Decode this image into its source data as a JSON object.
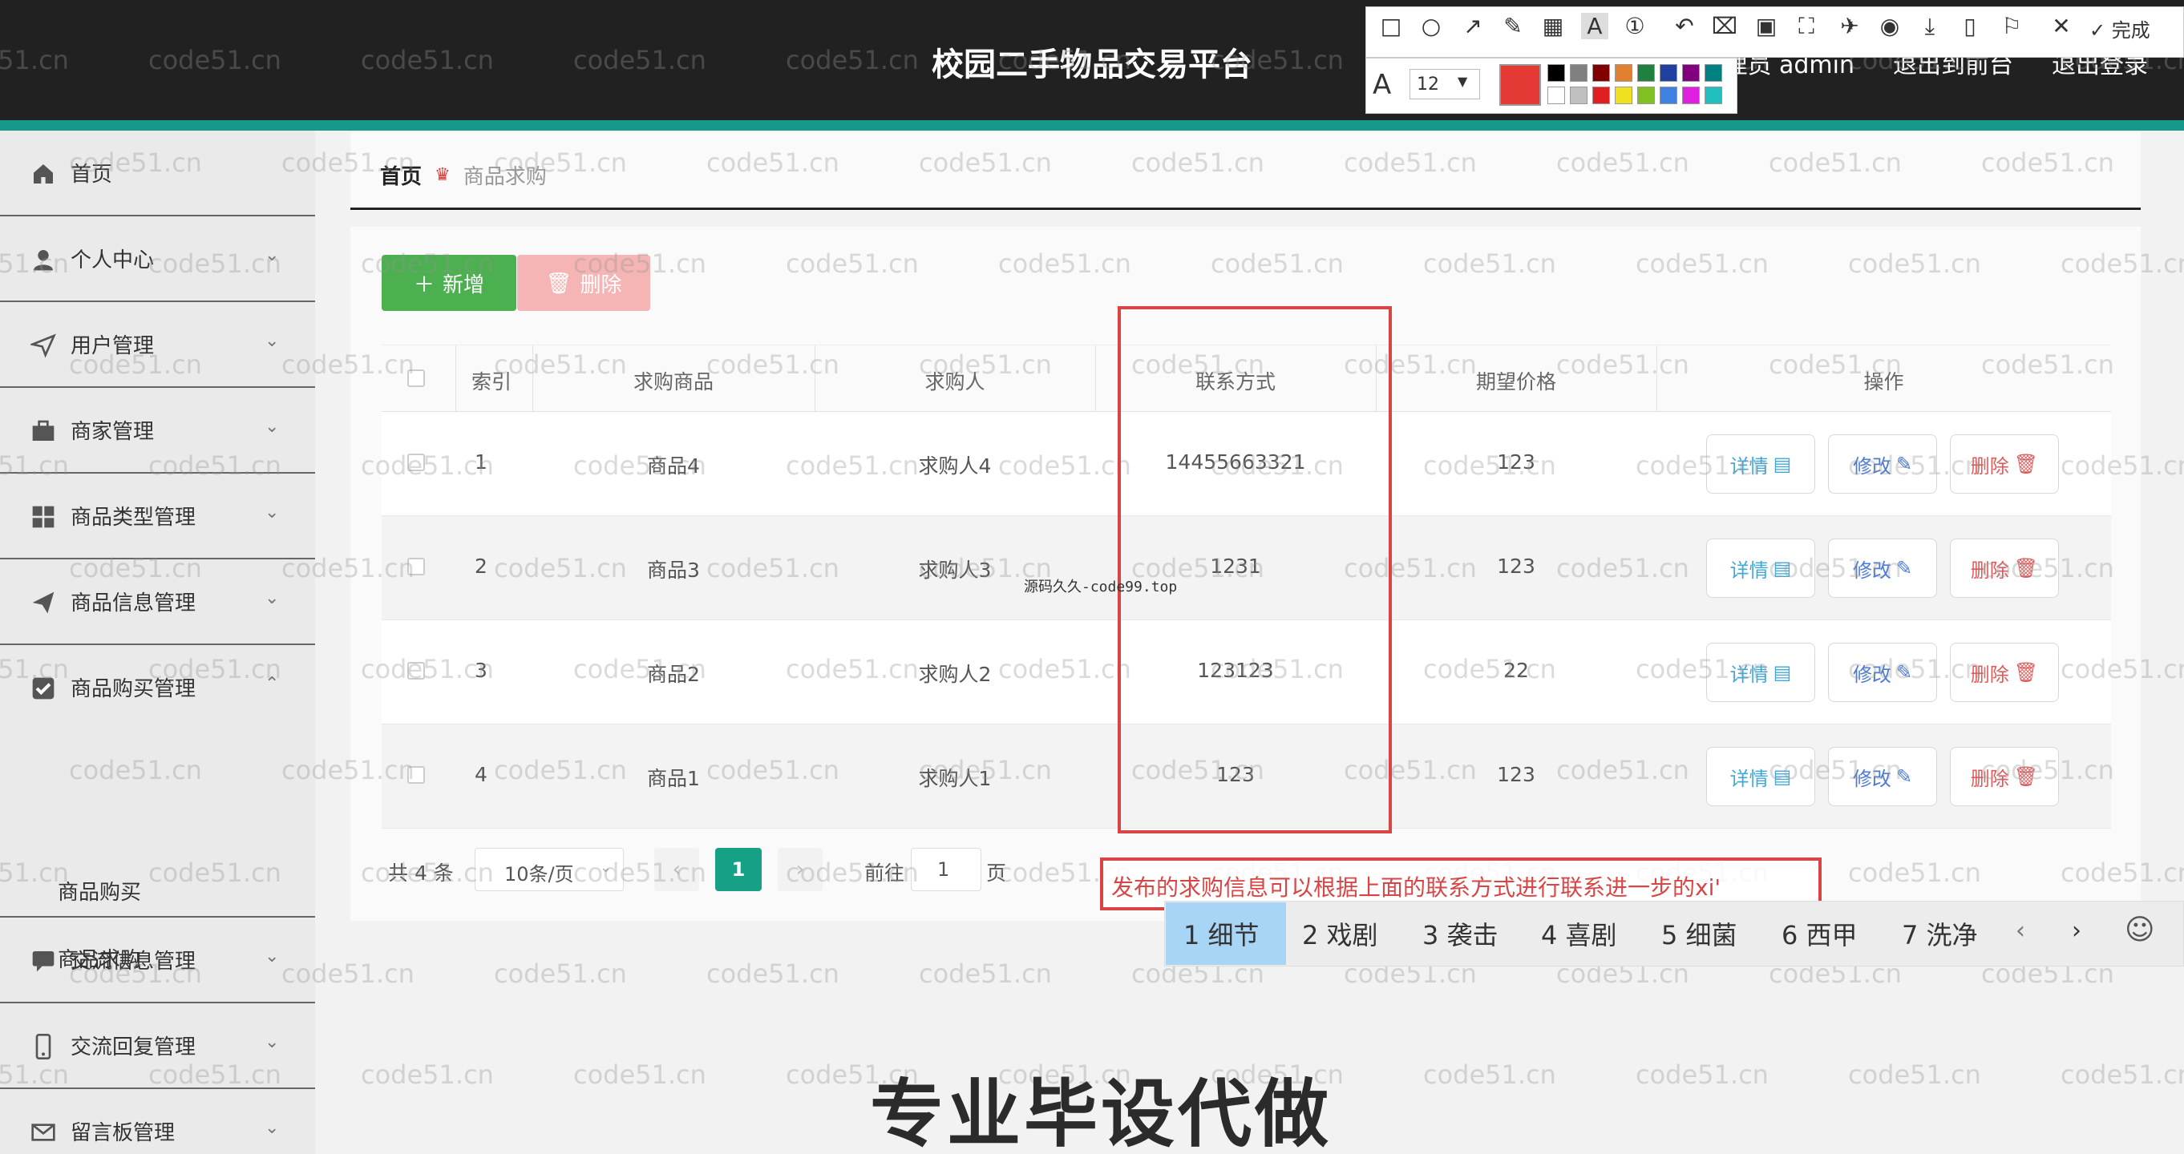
{
  "header": {
    "app_title": "校园二手物品交易平台",
    "user_label": "管理员 admin",
    "front_link": "退出到前台",
    "logout_link": "退出登录",
    "accent_color": "#16988a"
  },
  "sidebar": {
    "items": [
      {
        "label": "首页",
        "icon": "home-icon"
      },
      {
        "label": "个人中心",
        "icon": "user-icon"
      },
      {
        "label": "用户管理",
        "icon": "send-icon"
      },
      {
        "label": "商家管理",
        "icon": "briefcase-icon"
      },
      {
        "label": "商品类型管理",
        "icon": "grid-icon"
      },
      {
        "label": "商品信息管理",
        "icon": "paper-plane-icon"
      },
      {
        "label": "商品购买管理",
        "icon": "checkbox-icon"
      },
      {
        "label": "交流信息管理",
        "icon": "message-icon"
      },
      {
        "label": "交流回复管理",
        "icon": "phone-icon"
      },
      {
        "label": "留言板管理",
        "icon": "mail-icon"
      }
    ],
    "submenu": [
      {
        "label": "商品购买"
      },
      {
        "label": "商品求购"
      }
    ]
  },
  "breadcrumb": {
    "home": "首页",
    "current": "商品求购"
  },
  "toolbar": {
    "add_label": "新增",
    "delete_label": "删除"
  },
  "table": {
    "headers": [
      "索引",
      "求购商品",
      "求购人",
      "联系方式",
      "期望价格",
      "操作"
    ],
    "rows": [
      {
        "index": "1",
        "product": "商品4",
        "buyer": "求购人4",
        "contact": "14455663321",
        "price": "123"
      },
      {
        "index": "2",
        "product": "商品3",
        "buyer": "求购人3",
        "contact": "1231",
        "price": "123"
      },
      {
        "index": "3",
        "product": "商品2",
        "buyer": "求购人2",
        "contact": "123123",
        "price": "22"
      },
      {
        "index": "4",
        "product": "商品1",
        "buyer": "求购人1",
        "contact": "123",
        "price": "123"
      }
    ],
    "actions": {
      "detail": "详情",
      "edit": "修改",
      "delete": "删除"
    }
  },
  "pagination": {
    "total": "共 4 条",
    "page_size": "10条/页",
    "current_page": "1",
    "goto_label": "前往",
    "goto_value": "1",
    "page_word": "页"
  },
  "annotation": {
    "text": "发布的求购信息可以根据上面的联系方式进行联系进一步的xi'",
    "color": "#d94545"
  },
  "screenshot_tool": {
    "done_label": "完成",
    "font_size": "12",
    "current_color": "#e53935",
    "swatches": [
      "#000000",
      "#808080",
      "#800000",
      "#e08030",
      "#208040",
      "#2040a0",
      "#800080",
      "#008080",
      "#ffffff",
      "#c0c0c0",
      "#e02020",
      "#f0e020",
      "#80c020",
      "#4080e0",
      "#e020e0",
      "#20c0c0"
    ]
  },
  "ime": {
    "candidates": [
      "1 细节",
      "2 戏剧",
      "3 袭击",
      "4 喜剧",
      "5 细菌",
      "6 西甲",
      "7 洗净"
    ]
  },
  "overlays": {
    "site_mark": "源码久久-code99.top",
    "promo": "专业毕设代做",
    "watermark": "code51.cn"
  }
}
